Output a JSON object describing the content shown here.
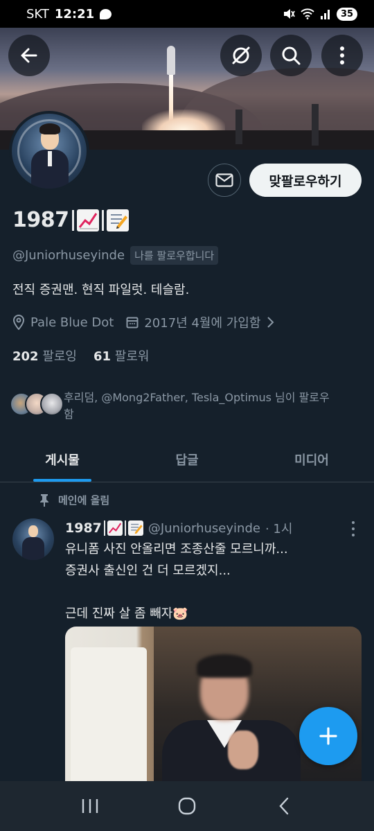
{
  "status_bar": {
    "carrier": "SKT",
    "time": "12:21",
    "battery": "35"
  },
  "profile": {
    "name": "1987",
    "handle": "@Juniorhuseyinde",
    "follows_you": "나를 팔로우합니다",
    "bio": "전직 증권맨. 현직 파일럿. 테슬람.",
    "location": "Pale Blue Dot",
    "joined": "2017년 4월에 가입함",
    "following_count": "202",
    "following_label": "팔로잉",
    "followers_count": "61",
    "followers_label": "팔로워",
    "followed_by_text": "후리덤, @Mong2Father, Tesla_Optimus 님이 팔로우함",
    "follow_button": "맞팔로우하기"
  },
  "tabs": [
    {
      "label": "게시물",
      "active": true
    },
    {
      "label": "답글",
      "active": false
    },
    {
      "label": "미디어",
      "active": false
    }
  ],
  "pinned_label": "메인에 올림",
  "tweet": {
    "name": "1987",
    "handle": "@Juniorhuseyinde",
    "time": "· 1시",
    "text": "유니폼 사진 안올리면 조종산줄 모르니까...\n증권사 출신인 건 더 모르겠지...\n\n근데 진짜 살 좀 빼자🐷"
  },
  "colors": {
    "background": "#15202b",
    "accent": "#1d9bf0",
    "muted_text": "#8b98a5"
  },
  "icons": [
    "back-arrow-icon",
    "no-signal-icon",
    "search-icon",
    "more-vertical-icon",
    "mail-icon",
    "location-pin-icon",
    "calendar-icon",
    "chevron-right-icon",
    "pin-icon",
    "plus-icon"
  ]
}
